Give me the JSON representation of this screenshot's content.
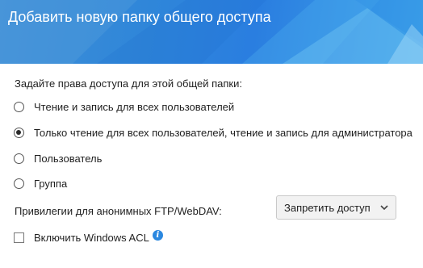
{
  "dialog": {
    "title": "Добавить новую папку общего доступа"
  },
  "access": {
    "prompt": "Задайте права доступа для этой общей папки:",
    "options": [
      {
        "label": "Чтение и запись для всех пользователей",
        "selected": false
      },
      {
        "label": "Только чтение для всех пользователей, чтение и запись для администратора",
        "selected": true
      },
      {
        "label": "Пользователь",
        "selected": false
      },
      {
        "label": "Группа",
        "selected": false
      }
    ]
  },
  "ftp": {
    "label": "Привилегии для анонимных FTP/WebDAV:",
    "selected_value": "Запретить доступ"
  },
  "windows_acl": {
    "label": "Включить Windows ACL",
    "checked": false,
    "info_icon": "info-icon"
  },
  "colors": {
    "header_gradient_start": "#3f8fd7",
    "header_gradient_end": "#3fa3ea",
    "header_text": "#ffffff",
    "info_icon": "#2b88e0"
  }
}
